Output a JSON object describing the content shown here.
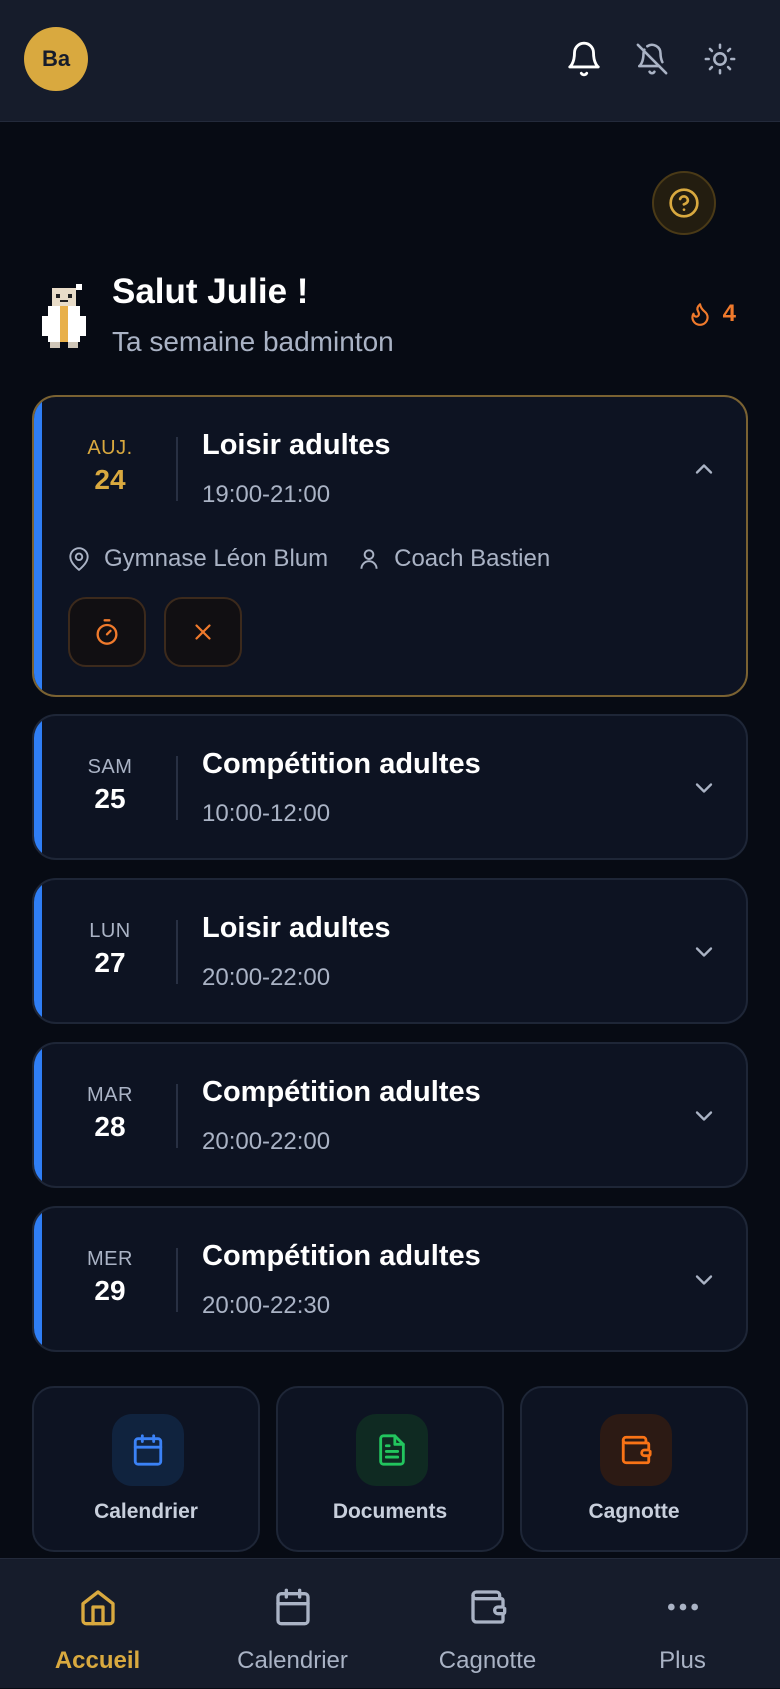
{
  "header": {
    "avatar_initials": "Ba",
    "icons": [
      "bell-icon",
      "bell-off-icon",
      "sun-icon"
    ]
  },
  "greeting": {
    "title": "Salut Julie !",
    "subtitle": "Ta semaine badminton",
    "streak": "4"
  },
  "sessions": [
    {
      "dow": "AUJ.",
      "day": "24",
      "title": "Loisir adultes",
      "time": "19:00-21:00",
      "expanded": true,
      "location": "Gymnase Léon Blum",
      "coach": "Coach Bastien"
    },
    {
      "dow": "SAM",
      "day": "25",
      "title": "Compétition adultes",
      "time": "10:00-12:00",
      "expanded": false
    },
    {
      "dow": "LUN",
      "day": "27",
      "title": "Loisir adultes",
      "time": "20:00-22:00",
      "expanded": false
    },
    {
      "dow": "MAR",
      "day": "28",
      "title": "Compétition adultes",
      "time": "20:00-22:00",
      "expanded": false
    },
    {
      "dow": "MER",
      "day": "29",
      "title": "Compétition adultes",
      "time": "20:00-22:30",
      "expanded": false
    }
  ],
  "quick_links": [
    {
      "label": "Calendrier",
      "color": "#3b82f6"
    },
    {
      "label": "Documents",
      "color": "#22c55e"
    },
    {
      "label": "Cagnotte",
      "color": "#f97316"
    }
  ],
  "nav": [
    {
      "label": "Accueil",
      "active": true
    },
    {
      "label": "Calendrier",
      "active": false
    },
    {
      "label": "Cagnotte",
      "active": false
    },
    {
      "label": "Plus",
      "active": false
    }
  ],
  "colors": {
    "accent": "#d9a93f",
    "session_bar": "#2f7ef5",
    "streak": "#f07a2c"
  }
}
